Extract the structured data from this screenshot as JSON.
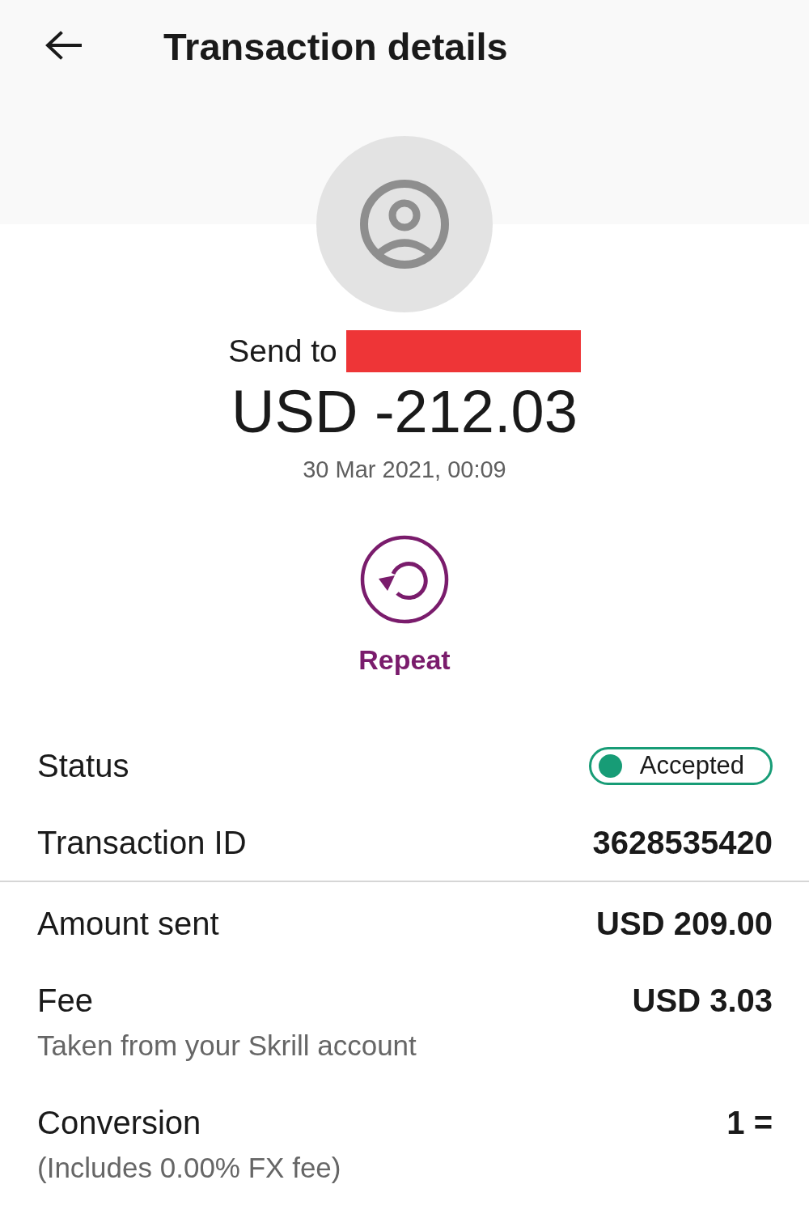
{
  "header": {
    "title": "Transaction details"
  },
  "transfer": {
    "recipient_label": "Send to",
    "recipient_redacted": true,
    "amount": "USD -212.03",
    "date": "30 Mar 2021, 00:09"
  },
  "actions": [
    {
      "kind": "repeat",
      "label": "Repeat"
    }
  ],
  "sections": [
    {
      "rows": [
        {
          "kind": "status",
          "label": "Status",
          "value": "Accepted",
          "color": "#179c76"
        },
        {
          "kind": "value",
          "label": "Transaction ID",
          "value": "3628535420"
        }
      ]
    },
    {
      "rows": [
        {
          "kind": "value",
          "label": "Amount sent",
          "value": "USD 209.00"
        },
        {
          "kind": "value",
          "label": "Fee",
          "value": "USD 3.03",
          "note": "Taken from your Skrill account"
        },
        {
          "kind": "value",
          "label": "Conversion",
          "value": "1 =",
          "note": "(Includes 0.00% FX fee)"
        }
      ]
    }
  ]
}
